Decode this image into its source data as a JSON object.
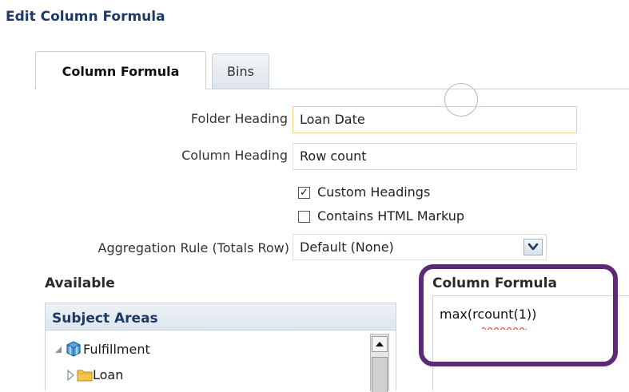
{
  "dialog": {
    "title": "Edit Column Formula"
  },
  "tabs": [
    {
      "label": "Column Formula",
      "active": true
    },
    {
      "label": "Bins",
      "active": false
    }
  ],
  "form": {
    "folder_heading": {
      "label": "Folder Heading",
      "value": "Loan Date"
    },
    "column_heading": {
      "label": "Column Heading",
      "value": "Row count"
    },
    "custom_headings": {
      "label": "Custom Headings",
      "checked": true,
      "check_glyph": "☑"
    },
    "html_markup": {
      "label": "Contains HTML Markup",
      "checked": false
    },
    "aggregation": {
      "label": "Aggregation Rule (Totals Row)",
      "value": "Default (None)"
    }
  },
  "available": {
    "heading": "Available",
    "panel_title": "Subject Areas",
    "tree": [
      {
        "label": "Fulfillment",
        "icon": "subject-area-cube-icon",
        "expanded": true
      },
      {
        "label": "Loan",
        "icon": "folder-icon",
        "expanded": false
      }
    ]
  },
  "formula": {
    "heading": "Column Formula",
    "text": "max(rcount(1))"
  },
  "colors": {
    "title": "#1c3a63",
    "highlight": "#5d2a78",
    "active_field_border": "#f0d08a",
    "spellcheck_underline": "#e53935"
  }
}
